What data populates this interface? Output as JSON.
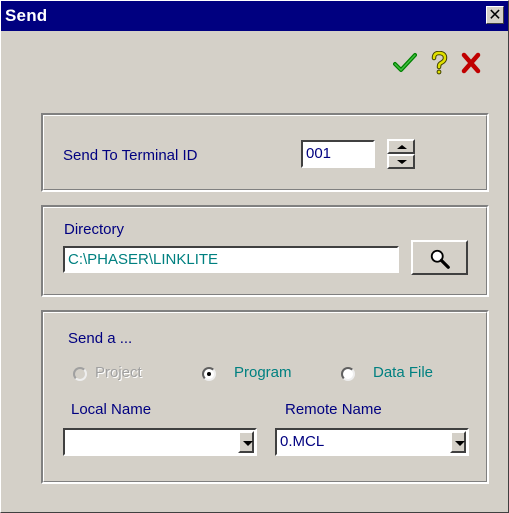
{
  "window": {
    "title": "Send",
    "close_glyph": "✕"
  },
  "toolbar": {
    "ok_icon": "checkmark-icon",
    "help_icon": "question-icon",
    "cancel_icon": "x-icon",
    "colors": {
      "ok": "#008000",
      "help": "#c0c000",
      "cancel": "#c00000"
    }
  },
  "terminal": {
    "label": "Send To Terminal ID",
    "value": "001"
  },
  "directory": {
    "label": "Directory",
    "value": "C:\\PHASER\\LINKLITE",
    "browse_icon": "magnifier-icon"
  },
  "send": {
    "label": "Send a ...",
    "options": [
      {
        "label": "Project",
        "selected": false,
        "enabled": false
      },
      {
        "label": "Program",
        "selected": true,
        "enabled": true
      },
      {
        "label": "Data File",
        "selected": false,
        "enabled": true
      }
    ],
    "local_name_label": "Local Name",
    "local_name_value": "",
    "remote_name_label": "Remote Name",
    "remote_name_value": "0.MCL"
  }
}
